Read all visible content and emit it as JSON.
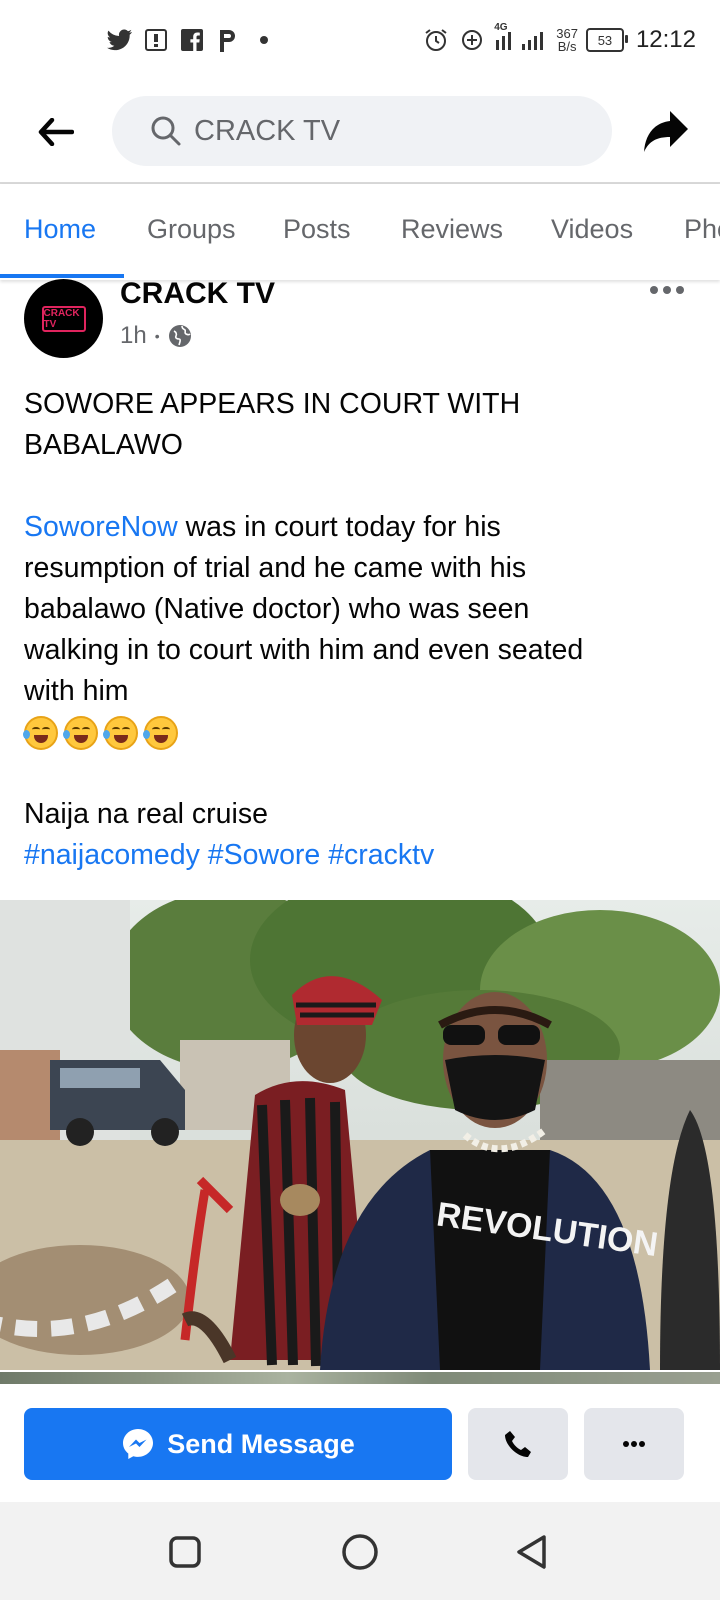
{
  "status_bar": {
    "left_icons": [
      "twitter-icon",
      "message-icon",
      "facebook-icon",
      "pinterest-icon",
      "dot-icon"
    ],
    "right_icons": [
      "alarm-icon",
      "data-saver-icon",
      "signal-icon"
    ],
    "network": "4G",
    "net_speed_value": "367",
    "net_speed_unit": "B/s",
    "battery": "53",
    "time": "12:12"
  },
  "header": {
    "search_text": "CRACK TV"
  },
  "tabs": [
    {
      "label": "Home",
      "active": true
    },
    {
      "label": "Groups",
      "active": false
    },
    {
      "label": "Posts",
      "active": false
    },
    {
      "label": "Reviews",
      "active": false
    },
    {
      "label": "Videos",
      "active": false
    },
    {
      "label": "Pho",
      "active": false
    }
  ],
  "post": {
    "page_name": "CRACK TV",
    "time": "1h",
    "separator": "•",
    "avatar_text": "CRACK TV",
    "headline_line1": "SOWORE APPEARS IN COURT WITH",
    "headline_line2": "BABALAWO",
    "mention": "SoworeNow",
    "body_line1": " was in court today for his",
    "body_line2": "resumption of trial and he came with his",
    "body_line3": "babalawo (Native doctor) who was seen",
    "body_line4": "walking in to court with him and even seated",
    "body_line5": "with him",
    "emoji_count": 4,
    "tagline": "Naija na real cruise",
    "hashtags": [
      "#naijacomedy",
      "#Sowore",
      "#cracktv"
    ],
    "photo_shirt_text": "REVOLUTION"
  },
  "actions": {
    "send_message_label": "Send Message"
  },
  "colors": {
    "accent": "#1877f2",
    "secondary_text": "#65676b",
    "button_gray": "#e4e6eb"
  }
}
